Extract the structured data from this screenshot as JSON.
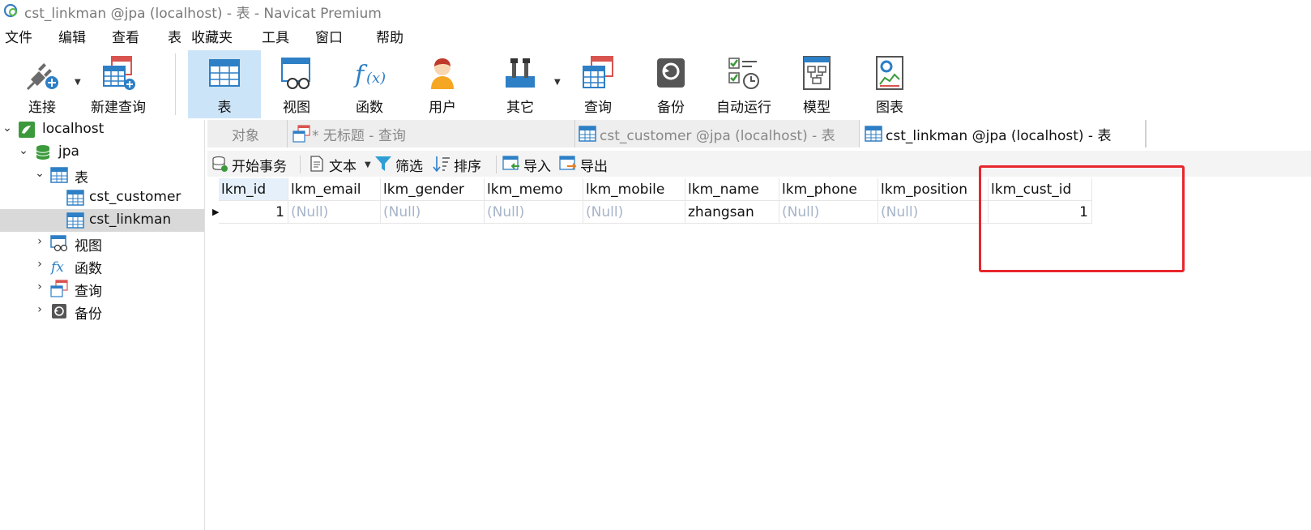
{
  "window": {
    "title": "cst_linkman @jpa (localhost) - 表 - Navicat Premium"
  },
  "menu": [
    "文件",
    "编辑",
    "查看",
    "表",
    "收藏夹",
    "工具",
    "窗口",
    "帮助"
  ],
  "toolbar": {
    "connect": "连接",
    "new_query": "新建查询",
    "table": "表",
    "view": "视图",
    "function": "函数",
    "user": "用户",
    "other": "其它",
    "query": "查询",
    "backup": "备份",
    "autorun": "自动运行",
    "model": "模型",
    "chart": "图表"
  },
  "sidebar": {
    "connection": "localhost",
    "database": "jpa",
    "tables_group": "表",
    "tables": [
      "cst_customer",
      "cst_linkman"
    ],
    "views_group": "视图",
    "functions_group": "函数",
    "queries_group": "查询",
    "backups_group": "备份"
  },
  "tabs": {
    "objects": "对象",
    "untitled_query": "* 无标题 - 查询",
    "customer": "cst_customer @jpa (localhost) - 表",
    "linkman": "cst_linkman @jpa (localhost) - 表"
  },
  "actions": {
    "begin_transaction": "开始事务",
    "text": "文本",
    "filter": "筛选",
    "sort": "排序",
    "import": "导入",
    "export": "导出"
  },
  "grid": {
    "columns": [
      "lkm_id",
      "lkm_email",
      "lkm_gender",
      "lkm_memo",
      "lkm_mobile",
      "lkm_name",
      "lkm_phone",
      "lkm_position",
      "lkm_cust_id"
    ],
    "rows": [
      [
        "1",
        "(Null)",
        "(Null)",
        "(Null)",
        "(Null)",
        "zhangsan",
        "(Null)",
        "(Null)",
        "1"
      ]
    ]
  },
  "colors": {
    "highlight": "#e8262d",
    "selected_tool": "#cce4f7",
    "null_text": "#a6b4c8"
  }
}
